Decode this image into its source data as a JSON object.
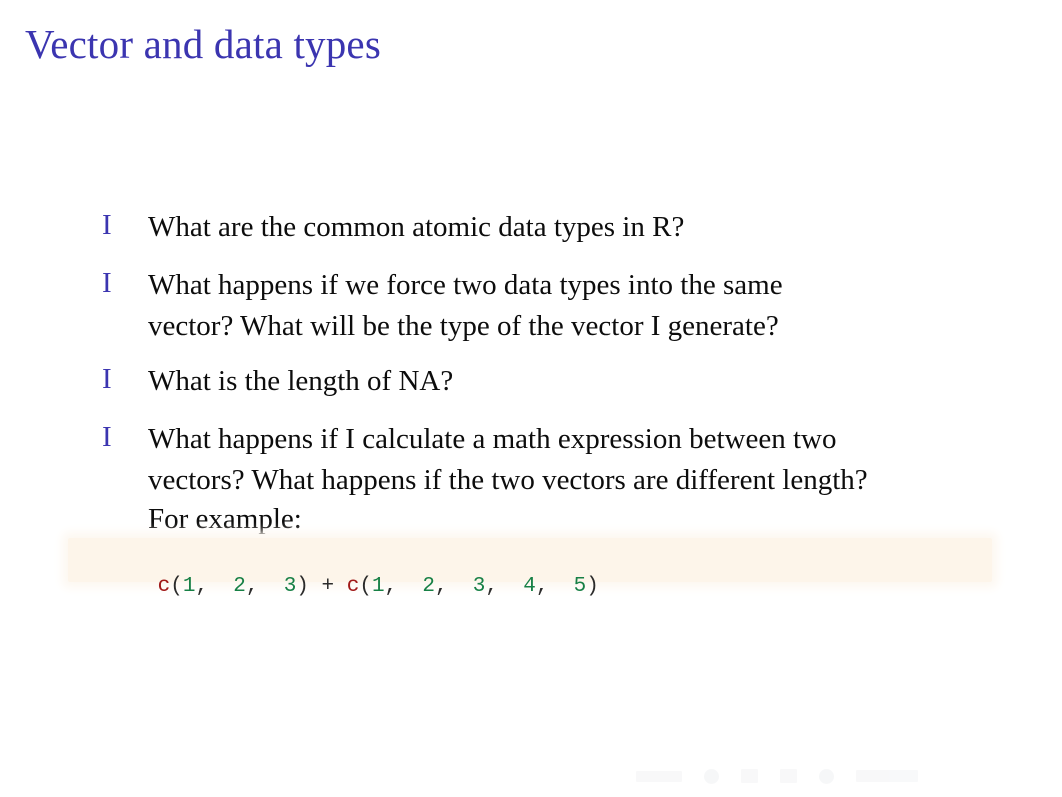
{
  "slide": {
    "title": "Vector and data types",
    "title_color": "#3b35b0",
    "background_color": "#ffffff",
    "body_text_color": "#0d0d0d",
    "bullet_marker": "I",
    "bullet_color": "#3b35b0"
  },
  "bullets": [
    {
      "marker": "I",
      "lines": [
        "What are the common atomic data types in R?"
      ]
    },
    {
      "marker": "I",
      "lines": [
        "What happens if we force two data types into the same",
        "vector? What will be the type of the vector I generate?"
      ]
    },
    {
      "marker": "I",
      "lines": [
        "What is the length of NA?"
      ]
    },
    {
      "marker": "I",
      "lines": [
        "What happens if I calculate a math expression between two",
        "vectors? What happens if the two vectors are different length?",
        "For example:"
      ]
    }
  ],
  "code_block": {
    "background_color": "#fdf5ea",
    "full_text": "c(1,  2,  3) + c(1,  2,  3,  4,  5)",
    "tokens": [
      {
        "text": "c",
        "type": "function",
        "color": "#a01818"
      },
      {
        "text": "(",
        "type": "punctuation",
        "color": "#2b2b2b"
      },
      {
        "text": "1",
        "type": "number",
        "color": "#178046"
      },
      {
        "text": ",  ",
        "type": "punctuation",
        "color": "#2b2b2b"
      },
      {
        "text": "2",
        "type": "number",
        "color": "#178046"
      },
      {
        "text": ",  ",
        "type": "punctuation",
        "color": "#2b2b2b"
      },
      {
        "text": "3",
        "type": "number",
        "color": "#178046"
      },
      {
        "text": ")",
        "type": "punctuation",
        "color": "#2b2b2b"
      },
      {
        "text": " + ",
        "type": "operator",
        "color": "#2b2b2b"
      },
      {
        "text": "c",
        "type": "function",
        "color": "#a01818"
      },
      {
        "text": "(",
        "type": "punctuation",
        "color": "#2b2b2b"
      },
      {
        "text": "1",
        "type": "number",
        "color": "#178046"
      },
      {
        "text": ",  ",
        "type": "punctuation",
        "color": "#2b2b2b"
      },
      {
        "text": "2",
        "type": "number",
        "color": "#178046"
      },
      {
        "text": ",  ",
        "type": "punctuation",
        "color": "#2b2b2b"
      },
      {
        "text": "3",
        "type": "number",
        "color": "#178046"
      },
      {
        "text": ",  ",
        "type": "punctuation",
        "color": "#2b2b2b"
      },
      {
        "text": "4",
        "type": "number",
        "color": "#178046"
      },
      {
        "text": ",  ",
        "type": "punctuation",
        "color": "#2b2b2b"
      },
      {
        "text": "5",
        "type": "number",
        "color": "#178046"
      },
      {
        "text": ")",
        "type": "punctuation",
        "color": "#2b2b2b"
      }
    ]
  },
  "navigation": {
    "icons": [
      "slide-prev-next-icon",
      "frame-prev-next-icon",
      "subsection-prev-next-icon",
      "section-prev-next-icon",
      "presentation-prev-next-icon",
      "back-forward-icon"
    ]
  }
}
